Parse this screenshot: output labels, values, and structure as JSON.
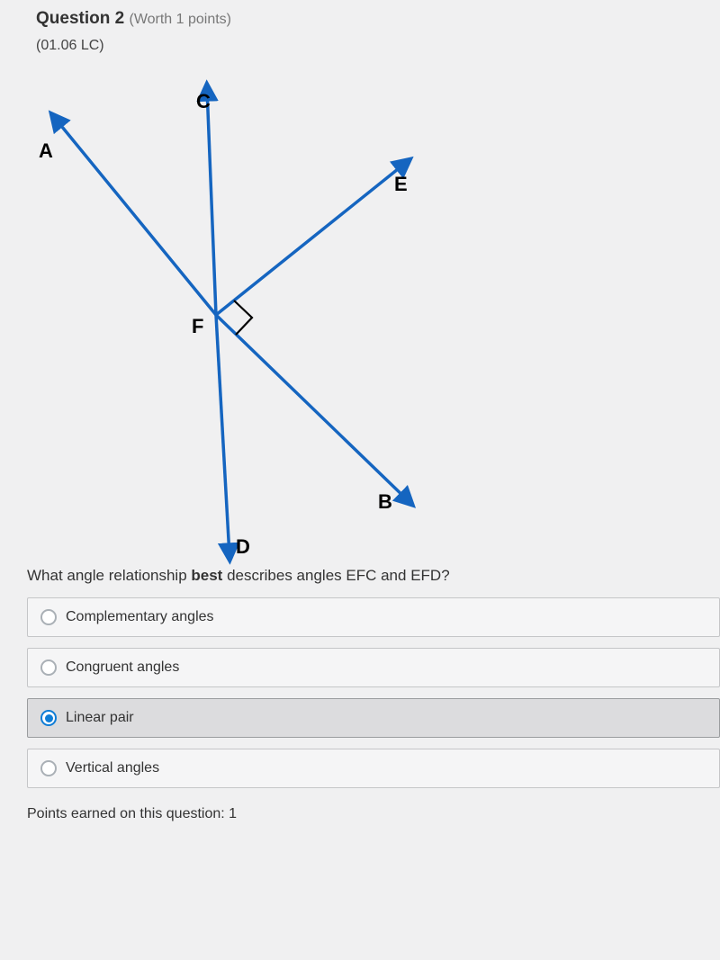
{
  "header": {
    "question_label": "Question",
    "question_number": "2",
    "worth": "(Worth 1 points)",
    "code": "(01.06 LC)"
  },
  "diagram": {
    "labels": {
      "A": "A",
      "B": "B",
      "C": "C",
      "D": "D",
      "E": "E",
      "F": "F"
    }
  },
  "question": {
    "prefix": "What angle relationship ",
    "emph": "best",
    "suffix": " describes angles EFC and EFD?"
  },
  "answers": [
    {
      "label": "Complementary angles",
      "selected": false
    },
    {
      "label": "Congruent angles",
      "selected": false
    },
    {
      "label": "Linear pair",
      "selected": true
    },
    {
      "label": "Vertical angles",
      "selected": false
    }
  ],
  "points_earned": "Points earned on this question: 1"
}
